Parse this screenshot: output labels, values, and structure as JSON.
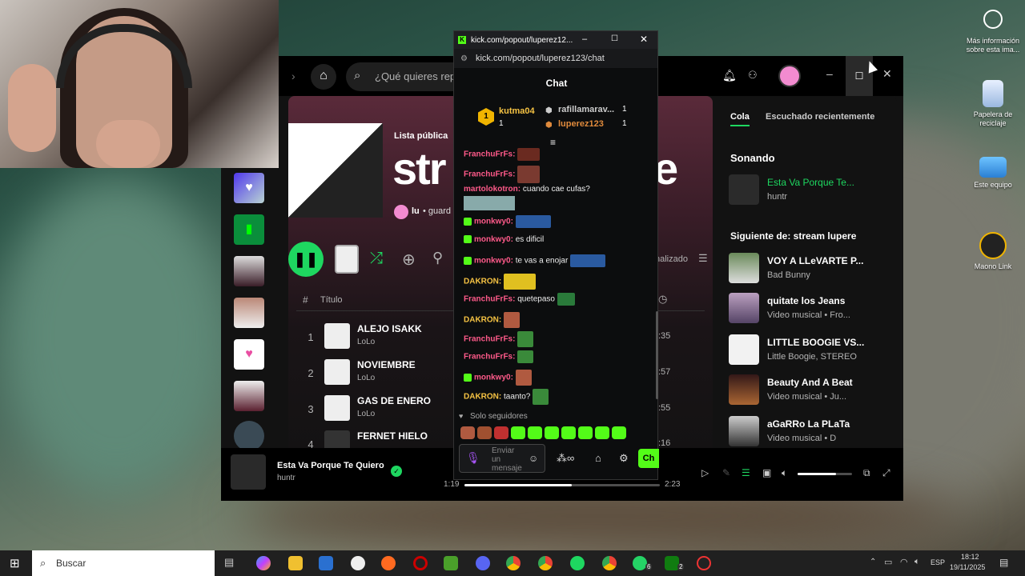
{
  "desktop": {
    "icons": [
      {
        "label": "Más información sobre esta ima...",
        "icon": "info-camera-icon"
      },
      {
        "label": "Papelera de reciclaje",
        "icon": "recycle-bin-icon"
      },
      {
        "label": "Este equipo",
        "icon": "computer-icon"
      },
      {
        "label": "Maono Link",
        "icon": "maono-link-icon"
      }
    ]
  },
  "spotify": {
    "search_placeholder": "¿Qué quieres rep",
    "playlist_type": "Lista pública",
    "playlist_title_left": "str",
    "playlist_title_right": "e",
    "owner": "lu",
    "owner_suffix": "• guard",
    "sort_label": "nalizado",
    "col_hash": "#",
    "col_title": "Título",
    "tracks": [
      {
        "num": "1",
        "name": "ALEJO ISAKK",
        "artist": "LoLo",
        "dur": ":35"
      },
      {
        "num": "2",
        "name": "NOVIEMBRE",
        "artist": "LoLo",
        "dur": ":57"
      },
      {
        "num": "3",
        "name": "GAS DE ENERO",
        "artist": "LoLo",
        "dur": ":55"
      },
      {
        "num": "4",
        "name": "FERNET HIELO",
        "artist": "",
        "dur": ":16"
      }
    ],
    "queue": {
      "tab_active": "Cola",
      "tab_other": "Escuchado recientemente",
      "now_heading": "Sonando",
      "now_title": "Esta Va Porque Te...",
      "now_artist": "huntr",
      "next_heading": "Siguiente de: stream lupere",
      "items": [
        {
          "title": "VOY A LLeVARTE P...",
          "meta": "Bad Bunny"
        },
        {
          "title": "quitate los Jeans",
          "meta": "Video musical • Fro..."
        },
        {
          "title": "LITTLE BOOGIE VS...",
          "meta": "Little Boogie, STEREO"
        },
        {
          "title": "Beauty And A Beat",
          "meta": "Video musical • Ju..."
        },
        {
          "title": "aGaRRo La PLaTa",
          "meta": "Video musical • D"
        }
      ]
    },
    "player": {
      "title": "Esta Va Porque Te Quiero",
      "artist": "huntr",
      "elapsed": "1:19",
      "total": "2:23",
      "progress": 0.55,
      "volume": 0.7
    }
  },
  "kick": {
    "window_title": "kick.com/popout/luperez12...",
    "url": "kick.com/popout/luperez123/chat",
    "header": "Chat",
    "leaders": [
      {
        "rank": "1",
        "name": "kutma04",
        "count": "1"
      },
      {
        "rank": "",
        "name": "rafillamarav...",
        "count": "1"
      },
      {
        "rank": "",
        "name": "luperez123",
        "count": "1"
      }
    ],
    "messages": [
      {
        "user": "FranchuFrFs:",
        "text": ""
      },
      {
        "user": "FranchuFrFs:",
        "text": ""
      },
      {
        "user": "martolokotron:",
        "text": "cuando cae cufas?"
      },
      {
        "user": "monkwy0:",
        "text": ""
      },
      {
        "user": "monkwy0:",
        "text": "es dificil"
      },
      {
        "user": "monkwy0:",
        "text": "te vas a enojar"
      },
      {
        "user": "DAKRON:",
        "text": ""
      },
      {
        "user": "FranchuFrFs:",
        "text": "quetepaso"
      },
      {
        "user": "DAKRON:",
        "text": ""
      },
      {
        "user": "FranchuFrFs:",
        "text": ""
      },
      {
        "user": "FranchuFrFs:",
        "text": ""
      },
      {
        "user": "monkwy0:",
        "text": ""
      },
      {
        "user": "DAKRON:",
        "text": "taanto?"
      }
    ],
    "followers_only": "Solo seguidores",
    "input_placeholder": "Enviar un mensaje",
    "send_label": "Ch"
  },
  "taskbar": {
    "search_placeholder": "Buscar",
    "lang": "ESP",
    "time": "18:12",
    "date": "19/11/2025",
    "whatsapp_badge": "6",
    "xbox_badge": "2"
  }
}
